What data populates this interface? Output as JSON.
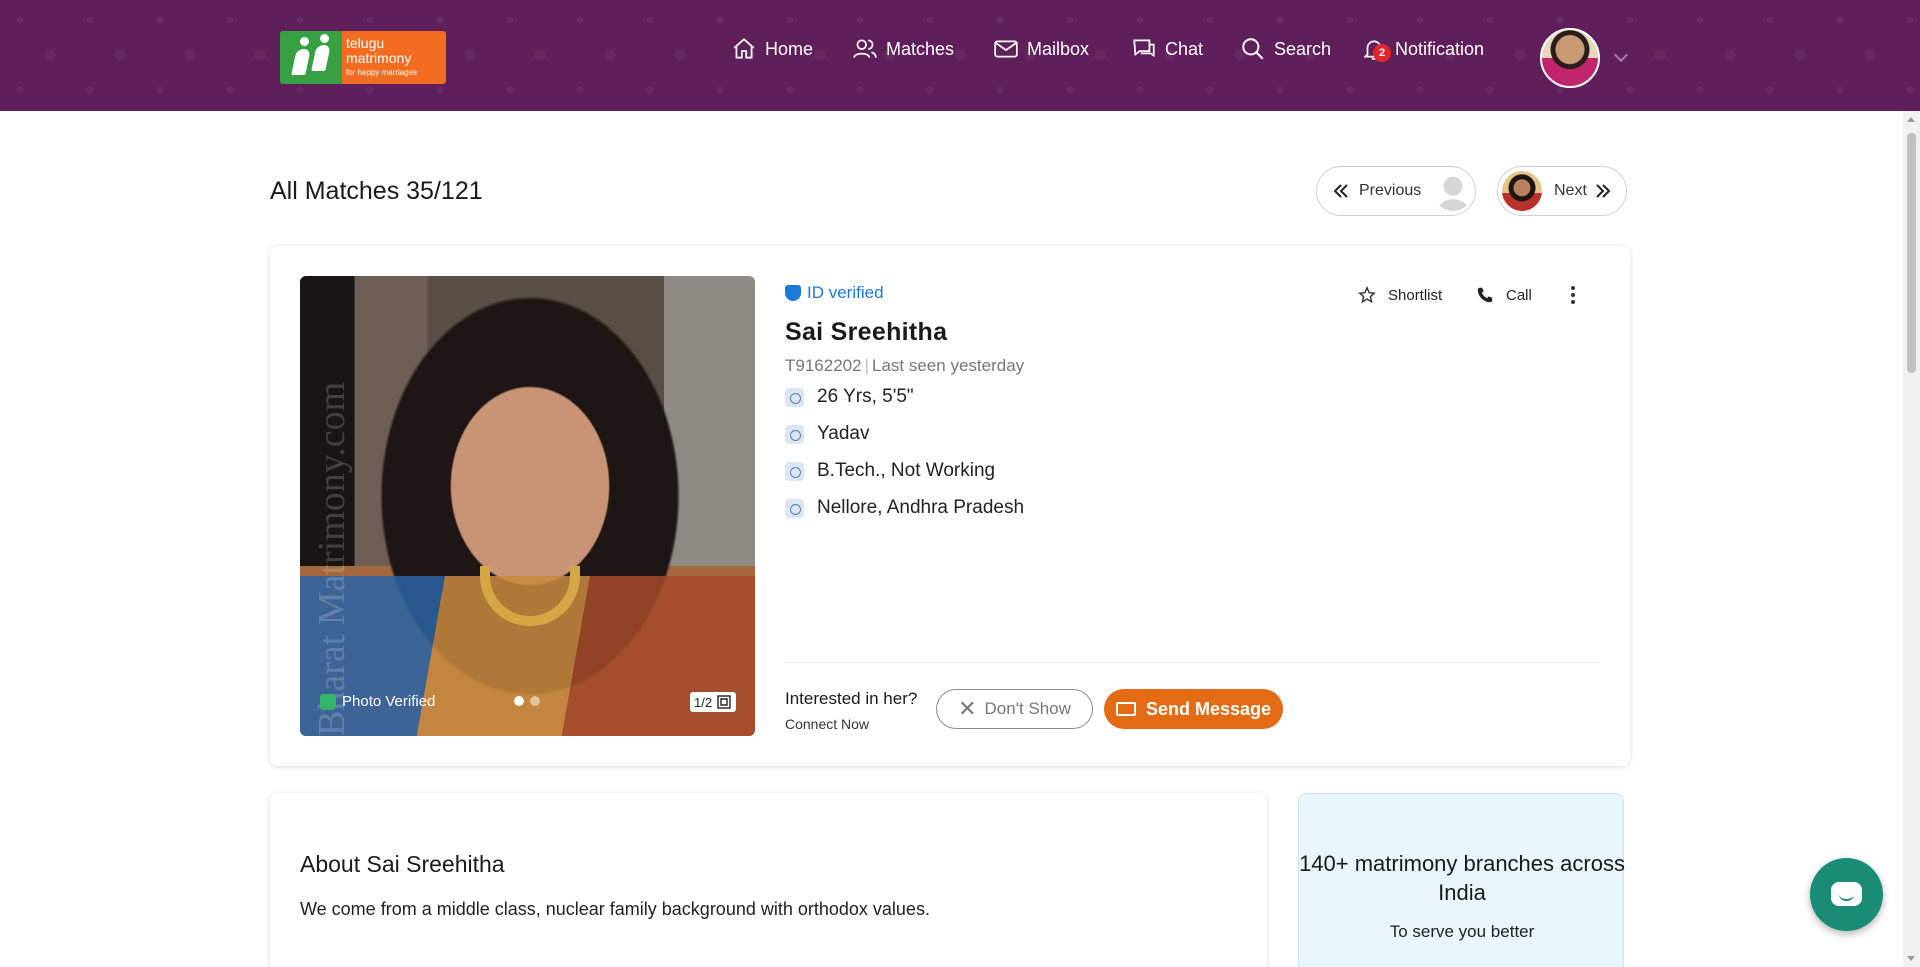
{
  "logo": {
    "line1": "telugu",
    "line2": "matrimony",
    "tagline": "for happy marriages"
  },
  "nav": {
    "items": [
      {
        "label": "Home",
        "icon": "home-icon"
      },
      {
        "label": "Matches",
        "icon": "users-icon"
      },
      {
        "label": "Mailbox",
        "icon": "mail-icon"
      },
      {
        "label": "Chat",
        "icon": "chat-icon"
      },
      {
        "label": "Search",
        "icon": "search-icon"
      },
      {
        "label": "Notification",
        "icon": "bell-icon",
        "badge": "2"
      }
    ]
  },
  "page": {
    "title": "All Matches 35/121"
  },
  "pager": {
    "previous_label": "Previous",
    "next_label": "Next"
  },
  "profile": {
    "id_verified_label": "ID verified",
    "name": "Sai Sreehitha",
    "id": "T9162202",
    "last_seen": "Last seen yesterday",
    "attributes": [
      {
        "icon": "age-icon",
        "text": "26 Yrs, 5'5\""
      },
      {
        "icon": "community-icon",
        "text": "Yadav"
      },
      {
        "icon": "education-icon",
        "text": "B.Tech., Not Working"
      },
      {
        "icon": "location-icon",
        "text": "Nellore, Andhra Pradesh"
      }
    ],
    "photo": {
      "watermark": "Bharat Matrimony.com",
      "verified_label": "Photo Verified",
      "counter": "1/2",
      "dots": 2,
      "active_dot": 0
    },
    "actions": {
      "shortlist_label": "Shortlist",
      "call_label": "Call"
    },
    "interest": {
      "question": "Interested in her?",
      "sub": "Connect Now",
      "dont_show_label": "Don't Show",
      "send_message_label": "Send Message"
    }
  },
  "about": {
    "title": "About Sai Sreehitha",
    "text": "We come from a middle class, nuclear family background with orthodox values."
  },
  "branches": {
    "title": "140+ matrimony branches across India",
    "subtitle": "To serve you better"
  },
  "colors": {
    "header_bg": "#5e1f5b",
    "accent_orange": "#e36b16",
    "id_verified_blue": "#1c79d6",
    "chat_fab": "#1a8c75",
    "badge_red": "#e1262d"
  }
}
